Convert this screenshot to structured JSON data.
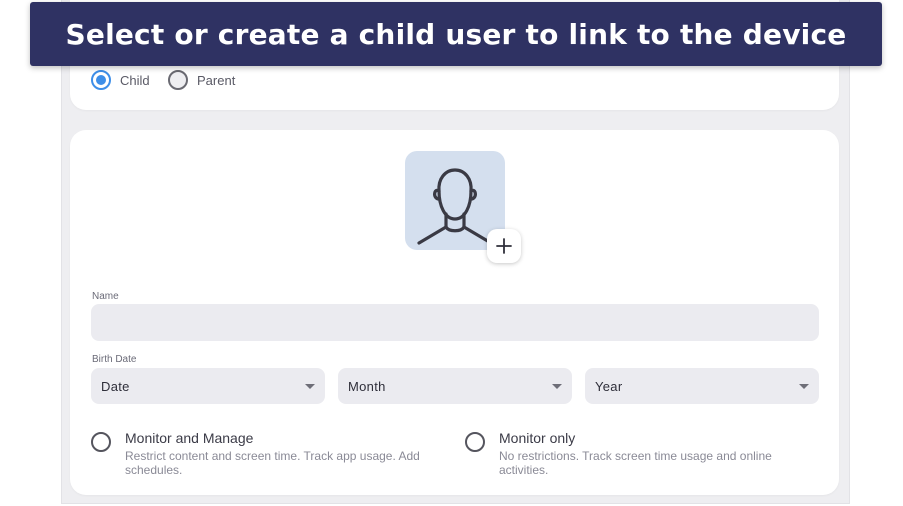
{
  "banner": {
    "text": "Select or create a child user to link to the device"
  },
  "user_type": {
    "options": [
      {
        "label": "Child",
        "selected": true
      },
      {
        "label": "Parent",
        "selected": false
      }
    ]
  },
  "avatar": {
    "icon": "person-avatar-icon",
    "add_icon": "plus-icon"
  },
  "form": {
    "name": {
      "label": "Name",
      "value": "",
      "placeholder": ""
    },
    "birth_date": {
      "label": "Birth Date",
      "date": "Date",
      "month": "Month",
      "year": "Year"
    }
  },
  "mode": {
    "options": [
      {
        "title": "Monitor and Manage",
        "description": "Restrict content and screen time. Track app usage. Add schedules.",
        "selected": false
      },
      {
        "title": "Monitor only",
        "description": "No restrictions. Track screen time usage and online activities.",
        "selected": false
      }
    ]
  },
  "colors": {
    "banner": "#2f3263",
    "accent": "#3d8ee8",
    "avatar_bg": "#d4dfee",
    "field_bg": "#ebebf0"
  }
}
